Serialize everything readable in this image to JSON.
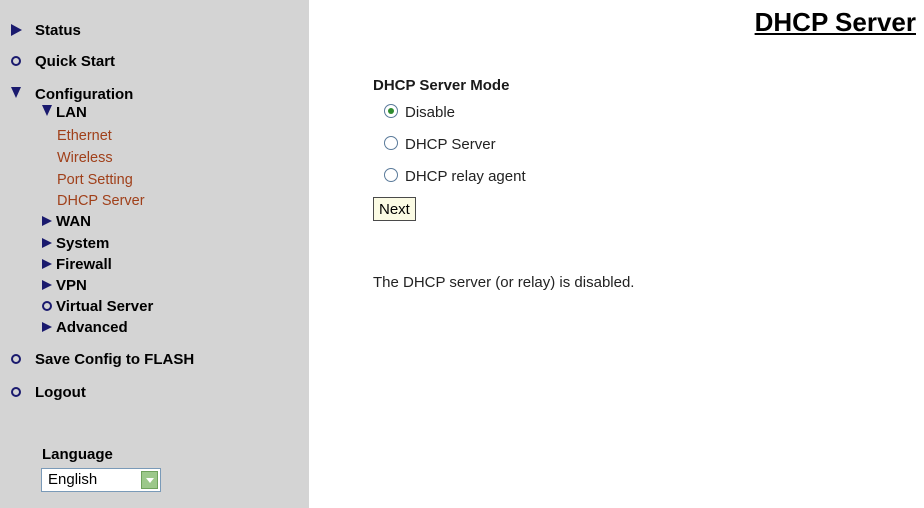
{
  "sidebar": {
    "status": "Status",
    "quick_start": "Quick Start",
    "configuration": "Configuration",
    "lan": "LAN",
    "lan_items": [
      "Ethernet",
      "Wireless",
      "Port Setting",
      "DHCP Server"
    ],
    "wan": "WAN",
    "system": "System",
    "firewall": "Firewall",
    "vpn": "VPN",
    "virtual_server": "Virtual Server",
    "advanced": "Advanced",
    "save_config": "Save Config to FLASH",
    "logout": "Logout",
    "language_label": "Language",
    "language_value": "English"
  },
  "main": {
    "title": "DHCP Server",
    "mode_heading": "DHCP Server Mode",
    "options": [
      "Disable",
      "DHCP Server",
      "DHCP relay agent"
    ],
    "selected_option": "Disable",
    "next_label": "Next",
    "status_text": "The DHCP server (or relay) is disabled."
  },
  "colors": {
    "sidebar_bg": "#d4d4d4",
    "icon_color": "#1a1a6e",
    "leaf_link_color": "#a0401a",
    "button_bg": "#fbfbe4"
  },
  "icons": {
    "expand": "triangle-right-icon",
    "collapse": "triangle-down-icon",
    "leaf": "circle-icon"
  }
}
